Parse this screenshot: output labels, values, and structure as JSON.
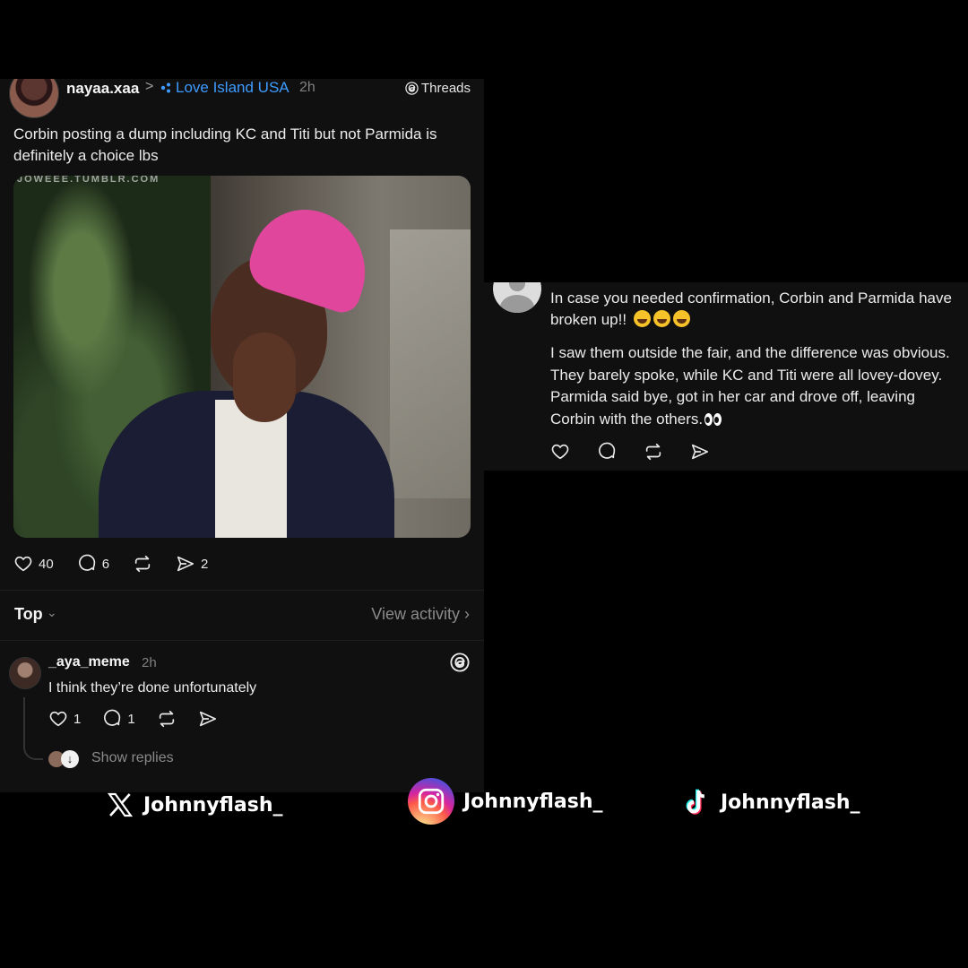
{
  "post": {
    "username": "nayaa.xaa",
    "chevron": ">",
    "community": "Love Island USA",
    "time": "2h",
    "platform": "Threads",
    "text": "Corbin posting a dump including KC and Titi but not Parmida is definitely a choice lbs",
    "media_watermark": "JOWEEE.TUMBLR.COM",
    "likes": "40",
    "comments": "6",
    "shares": "2"
  },
  "sort": {
    "label": "Top",
    "chevron": "⌄",
    "view_activity": "View activity  ›"
  },
  "comment": {
    "username": "_aya_meme",
    "time": "2h",
    "text": "I think they’re done unfortunately",
    "likes": "1",
    "replies": "1",
    "show_replies": "Show replies"
  },
  "reply_post": {
    "p1_text": "In case you needed confirmation, Corbin and Parmida have broken up!!",
    "p2_text": "I saw them outside the fair, and the difference was obvious. They barely spoke, while KC and Titi were all lovey-dovey. Parmida said bye, got in her car and drove off, leaving Corbin with the others."
  },
  "socials": {
    "x_handle": "Johnnyflash_",
    "instagram_handle": "Johnnyflash_",
    "tiktok_handle": "Johnnyflash_"
  },
  "colors": {
    "background": "#000000",
    "panel": "#101010",
    "link_blue": "#3e9bff",
    "muted": "#8a8a8a"
  }
}
